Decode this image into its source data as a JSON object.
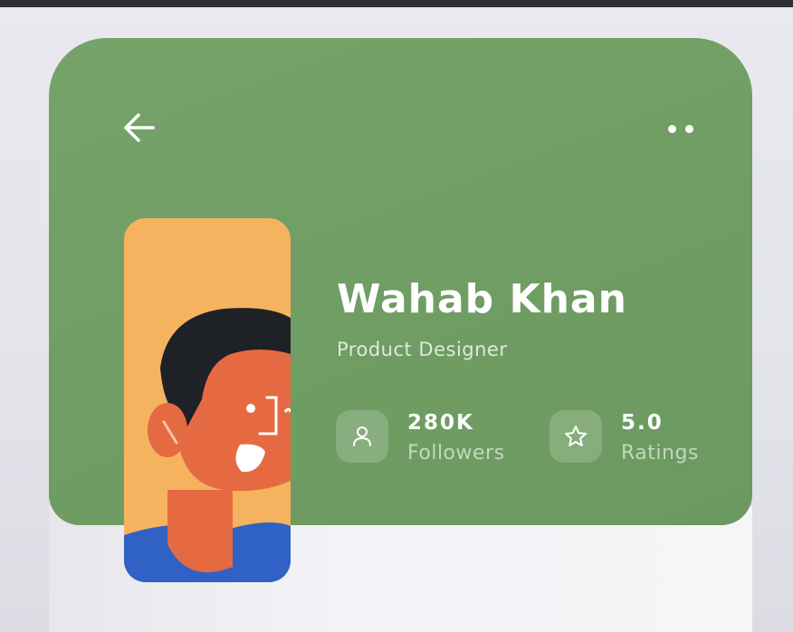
{
  "profile": {
    "name": "Wahab Khan",
    "role": "Product Designer"
  },
  "stats": [
    {
      "value": "280K",
      "label": "Followers",
      "icon": "user-icon"
    },
    {
      "value": "5.0",
      "label": "Ratings",
      "icon": "star-icon"
    }
  ],
  "header": {
    "back_icon": "arrow-left-icon",
    "more_icon": "more-dots-icon"
  },
  "colors": {
    "card_green": "#73a067",
    "avatar_bg": "#f6b35f",
    "skin": "#e56a42",
    "hair": "#1e2126",
    "shirt": "#2f62c4"
  }
}
